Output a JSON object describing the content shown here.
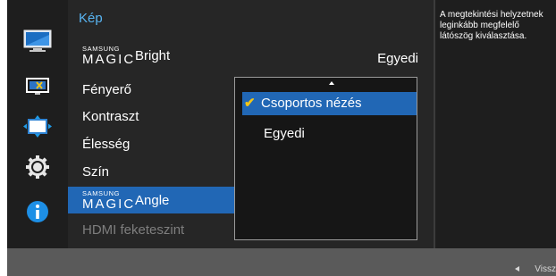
{
  "menu": {
    "title": "Kép",
    "items": [
      {
        "label": "Bright",
        "brand_small": "SAMSUNG",
        "brand_large": "MAGIC",
        "value": "Egyedi"
      },
      {
        "label": "Fényerő"
      },
      {
        "label": "Kontraszt"
      },
      {
        "label": "Élesség"
      },
      {
        "label": "Szín"
      },
      {
        "label": "Angle",
        "brand_small": "SAMSUNG",
        "brand_large": "MAGIC",
        "state": "selected"
      },
      {
        "label": "HDMI feketeszint",
        "state": "disabled"
      }
    ]
  },
  "dropdown": {
    "options": [
      {
        "label": "Csoportos nézés",
        "checked": true,
        "state": "selected"
      },
      {
        "label": "Egyedi",
        "checked": false
      }
    ]
  },
  "description": "A megtekintési helyzetnek leginkább megfelelő látószög kiválasztása.",
  "footer": {
    "back_label": "Vissz"
  },
  "sidebar_icons": [
    "monitor-icon",
    "picture-size-icon",
    "position-icon",
    "settings-gear-icon",
    "info-icon"
  ],
  "colors": {
    "accent": "#58b4f2",
    "selection": "#2167b5",
    "check": "#f2c516",
    "info": "#1d8fe6"
  }
}
